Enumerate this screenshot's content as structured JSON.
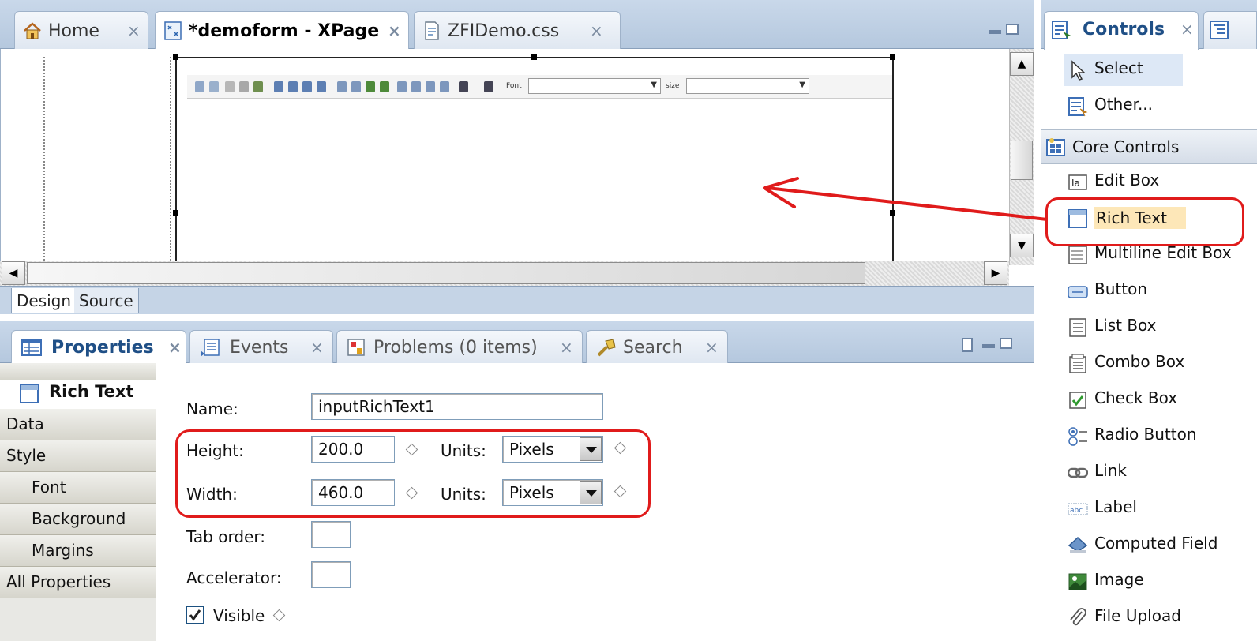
{
  "editor": {
    "tabs": [
      {
        "label": "Home",
        "icon": "home-icon",
        "active": false
      },
      {
        "label": "*demoform - XPage",
        "icon": "xpage-icon",
        "active": true
      },
      {
        "label": "ZFIDemo.css",
        "icon": "css-file-icon",
        "active": false
      }
    ],
    "close_glyph": "×",
    "rich_text_toolbar": {
      "font_label": "Font",
      "size_label": "size"
    },
    "bottom_tabs": [
      "Design",
      "Source"
    ],
    "scroll_up": "▲",
    "scroll_down": "▼",
    "scroll_left": "◀",
    "scroll_right": "▶"
  },
  "properties": {
    "tabs": [
      {
        "label": "Properties",
        "icon": "properties-icon",
        "active": true
      },
      {
        "label": "Events",
        "icon": "events-icon",
        "active": false
      },
      {
        "label": "Problems (0 items)",
        "icon": "problems-icon",
        "active": false
      },
      {
        "label": "Search",
        "icon": "search-icon",
        "active": false
      }
    ],
    "nav_header": "Rich Text",
    "nav": [
      "Data",
      "Style",
      "Font",
      "Background",
      "Margins",
      "All Properties"
    ],
    "fields": {
      "name_label": "Name:",
      "name_value": "inputRichText1",
      "height_label": "Height:",
      "height_value": "200.0",
      "width_label": "Width:",
      "width_value": "460.0",
      "units_label": "Units:",
      "units_value": "Pixels",
      "tab_order_label": "Tab order:",
      "accelerator_label": "Accelerator:",
      "visible_label": "Visible",
      "visible_checked": true
    }
  },
  "palette": {
    "tab_label": "Controls",
    "top_items": [
      {
        "label": "Select",
        "icon": "pointer-icon"
      },
      {
        "label": "Other...",
        "icon": "other-controls-icon"
      }
    ],
    "section_label": "Core Controls",
    "items": [
      {
        "label": "Edit Box",
        "icon": "edit-box-icon"
      },
      {
        "label": "Rich Text",
        "icon": "rich-text-icon"
      },
      {
        "label": "Multiline Edit Box",
        "icon": "multiline-edit-box-icon"
      },
      {
        "label": "Button",
        "icon": "button-icon"
      },
      {
        "label": "List Box",
        "icon": "list-box-icon"
      },
      {
        "label": "Combo Box",
        "icon": "combo-box-icon"
      },
      {
        "label": "Check Box",
        "icon": "check-box-icon"
      },
      {
        "label": "Radio Button",
        "icon": "radio-button-icon"
      },
      {
        "label": "Link",
        "icon": "link-icon"
      },
      {
        "label": "Label",
        "icon": "label-icon"
      },
      {
        "label": "Computed Field",
        "icon": "computed-field-icon"
      },
      {
        "label": "Image",
        "icon": "image-icon"
      },
      {
        "label": "File Upload",
        "icon": "file-upload-icon"
      }
    ]
  },
  "colors": {
    "annotation_red": "#e01b1b",
    "tab_bar_blue": "#c9d8ea",
    "highlight_orange": "#fde7b8",
    "select_blue": "#dde8f6"
  }
}
